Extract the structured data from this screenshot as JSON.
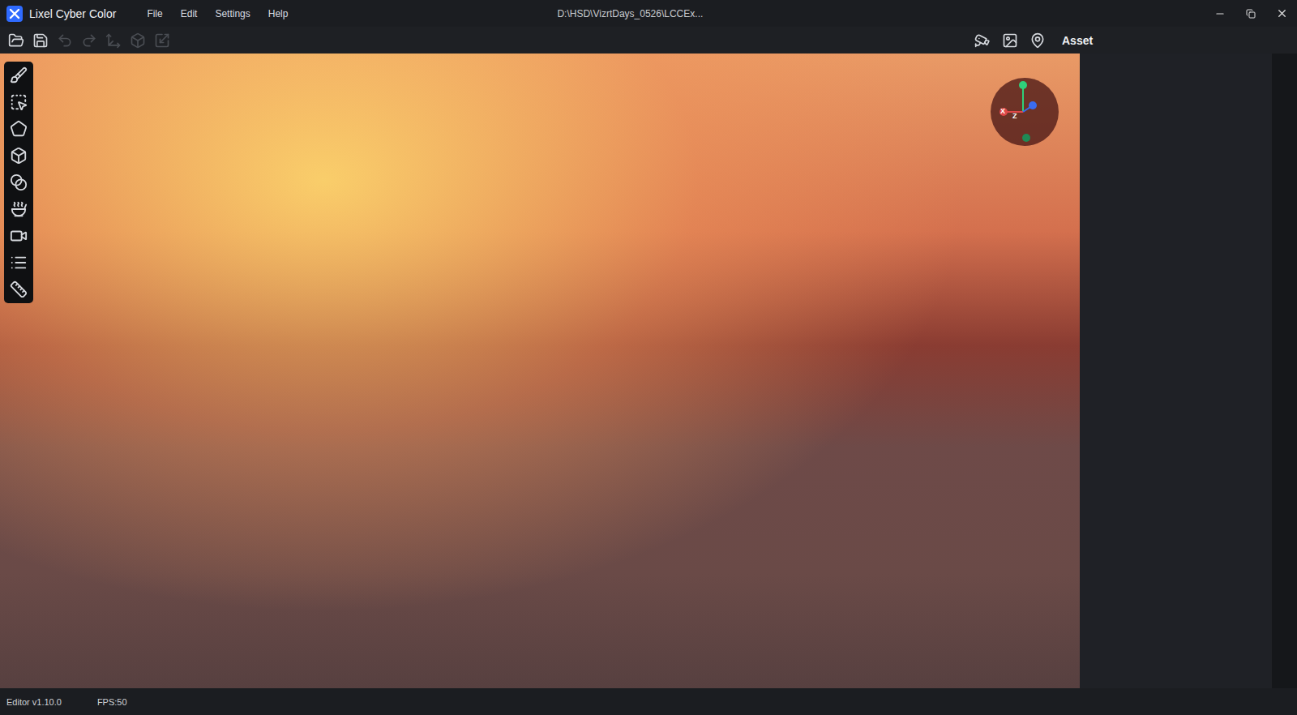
{
  "window": {
    "app_name": "Lixel Cyber Color",
    "title": "D:\\HSD\\VizrtDays_0526\\LCCEx..."
  },
  "menu": [
    "File",
    "Edit",
    "Settings",
    "Help"
  ],
  "toolbar": {
    "left": [
      {
        "disabled": false
      },
      {
        "disabled": false
      },
      {
        "disabled": true
      },
      {
        "disabled": true
      },
      {
        "disabled": true
      },
      {
        "disabled": true
      },
      {
        "disabled": true
      }
    ],
    "right_label": "Asset"
  },
  "gizmo": {
    "x_label": "X",
    "z_label": "Z"
  },
  "status_bar": {
    "version": "Editor v1.10.0",
    "fps": "FPS:50"
  }
}
